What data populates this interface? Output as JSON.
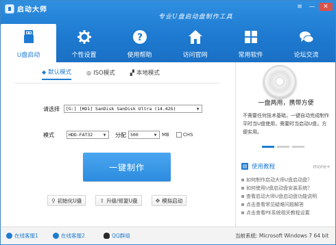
{
  "app": {
    "title": "启动大师",
    "slogan": "专业U盘启动盘制作工具"
  },
  "window_controls": {
    "menu": "≡",
    "minimize": "—",
    "close": "✕"
  },
  "nav": [
    {
      "label": "U盘启动",
      "icon": "usb-icon"
    },
    {
      "label": "个性设置",
      "icon": "gear-icon"
    },
    {
      "label": "使用帮助",
      "icon": "help-icon"
    },
    {
      "label": "访问官网",
      "icon": "home-icon"
    },
    {
      "label": "常用软件",
      "icon": "apps-icon"
    },
    {
      "label": "论坛交流",
      "icon": "chat-icon"
    }
  ],
  "mode_tabs": [
    {
      "label": "默认模式",
      "icon": "diamond-icon"
    },
    {
      "label": "ISO模式",
      "icon": "disc-icon"
    },
    {
      "label": "本地模式",
      "icon": "signal-icon"
    }
  ],
  "form": {
    "device_label": "请选择",
    "device_value": "[G:] [HD1] SanDisk SanDisk Ultra (14.42G)",
    "mode_label": "模式",
    "mode_value": "HDD-FAT32",
    "partition_label": "分配",
    "partition_value": "500",
    "partition_unit": "MB",
    "chs_label": "CHS"
  },
  "make_button": "一键制作",
  "tools": [
    {
      "label": "初始化U盘",
      "icon": "broom-icon"
    },
    {
      "label": "升级/修复U盘",
      "icon": "upgrade-icon"
    },
    {
      "label": "模拟启动",
      "icon": "simulate-icon"
    }
  ],
  "promo": {
    "title": "一盘两用，携带方便",
    "text": "不需要任何技术基础，一键自动完成制作平时当U盘使用，需要时当启动U盘，方便实用。"
  },
  "tutorial": {
    "title": "使用教程",
    "more": "more+",
    "items": [
      "如何制作启动大师U盘启动盘？",
      "如何使用U盘启动盘安装系统？",
      "查看启动大师U盘启动盘功能说明",
      "点击查看常见疑难问题解答",
      "点击查看PE系统相关教程设置"
    ]
  },
  "footer": {
    "service1": "在线客服1",
    "service2": "在线客服2",
    "qq": "QQ群组",
    "sysinfo": "当前系统: Microsoft Windows 7 64 bit"
  }
}
